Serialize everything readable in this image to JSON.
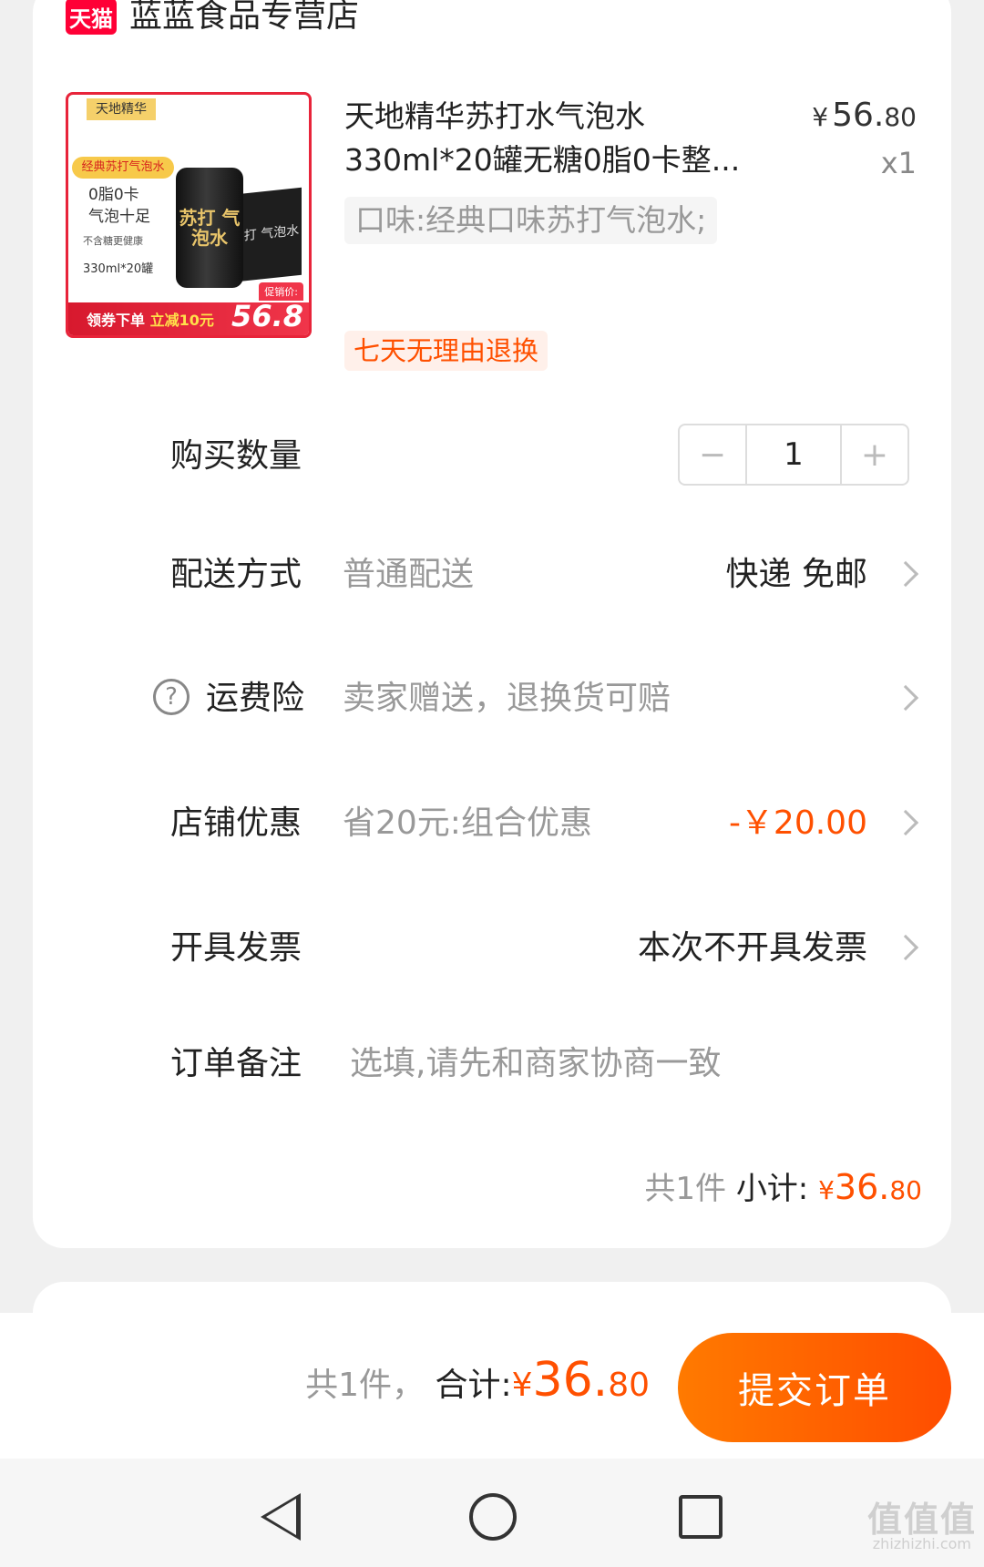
{
  "shop": {
    "logo_text": "天猫",
    "name": "蓝蓝食品专营店"
  },
  "product": {
    "title_line1": "天地精华苏打水气泡水",
    "title_line2": "330ml*20罐无糖0脂0卡整...",
    "price_currency": "¥",
    "price_int": "56.",
    "price_dec": "80",
    "quantity_label": "x1",
    "sku": "口味:经典口味苏打气泡水;",
    "return_badge": "七天无理由退换",
    "thumbnail": {
      "brand": "天地精华",
      "pill": "经典苏打气泡水",
      "line1": "0脂0卡",
      "line2": "气泡十足",
      "line3": "不含糖更健康",
      "line4": "330ml*20罐",
      "can_text": "苏打 气泡水",
      "box_text": "苏打 气泡水",
      "ribbon_text": "领券下单",
      "ribbon_accent": "立减10元",
      "promo_tag": "促销价:",
      "ribbon_price": "56.8"
    }
  },
  "rows": {
    "quantity": {
      "label": "购买数量",
      "value": "1",
      "minus": "−",
      "plus": "+"
    },
    "delivery": {
      "label": "配送方式",
      "value": "普通配送",
      "right": "快递 免邮"
    },
    "insurance": {
      "label": "运费险",
      "value": "卖家赠送，退换货可赔",
      "icon": "?"
    },
    "discount": {
      "label": "店铺优惠",
      "value": "省20元:组合优惠",
      "right": "-￥20.00"
    },
    "invoice": {
      "label": "开具发票",
      "right": "本次不开具发票"
    },
    "note": {
      "label": "订单备注",
      "placeholder": "选填,请先和商家协商一致"
    }
  },
  "subtotal": {
    "count": "共1件",
    "label": "小计:",
    "currency": "¥",
    "int": "36.",
    "dec": "80"
  },
  "footer": {
    "count": "共1件，",
    "label": "合计:",
    "currency": "¥",
    "int": "36.",
    "dec": "80",
    "submit": "提交订单"
  },
  "watermark": {
    "main": "值值值",
    "sub": "zhizhizhi.com"
  },
  "colors": {
    "accent": "#ff5000",
    "tmall": "#ff0036",
    "button_start": "#ff7a00",
    "button_end": "#ff4d00"
  },
  "icons": [
    "chevron-right-icon",
    "help-circle-icon",
    "back-nav-icon",
    "home-nav-icon",
    "recent-apps-icon"
  ]
}
